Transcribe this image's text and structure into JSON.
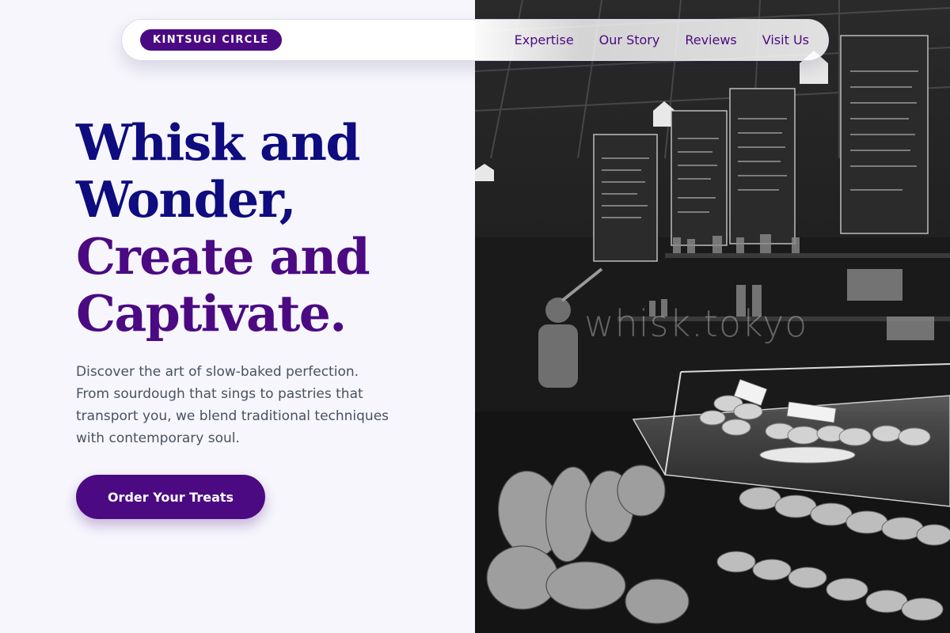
{
  "brand": {
    "name": "KINTSUGI CIRCLE"
  },
  "nav": {
    "links": [
      {
        "label": "Expertise"
      },
      {
        "label": "Our Story"
      },
      {
        "label": "Reviews"
      },
      {
        "label": "Visit Us"
      }
    ]
  },
  "hero": {
    "headline_line1": "Whisk and Wonder,",
    "headline_line2": "Create and Captivate.",
    "intro": "Discover the art of slow-baked perfection. From sourdough that sings to pastries that transport you, we blend traditional techniques with contemporary soul.",
    "cta_label": "Order Your Treats",
    "photo_watermark": "whisk.tokyo",
    "photo_alt": "Black and white photo of a bakery counter with breads, pastries and chalkboard menus"
  },
  "colors": {
    "brand_purple": "#4b0a82",
    "headline_navy": "#0e0c7f",
    "body_text": "#4a5160",
    "page_bg": "#f6f6fc"
  }
}
